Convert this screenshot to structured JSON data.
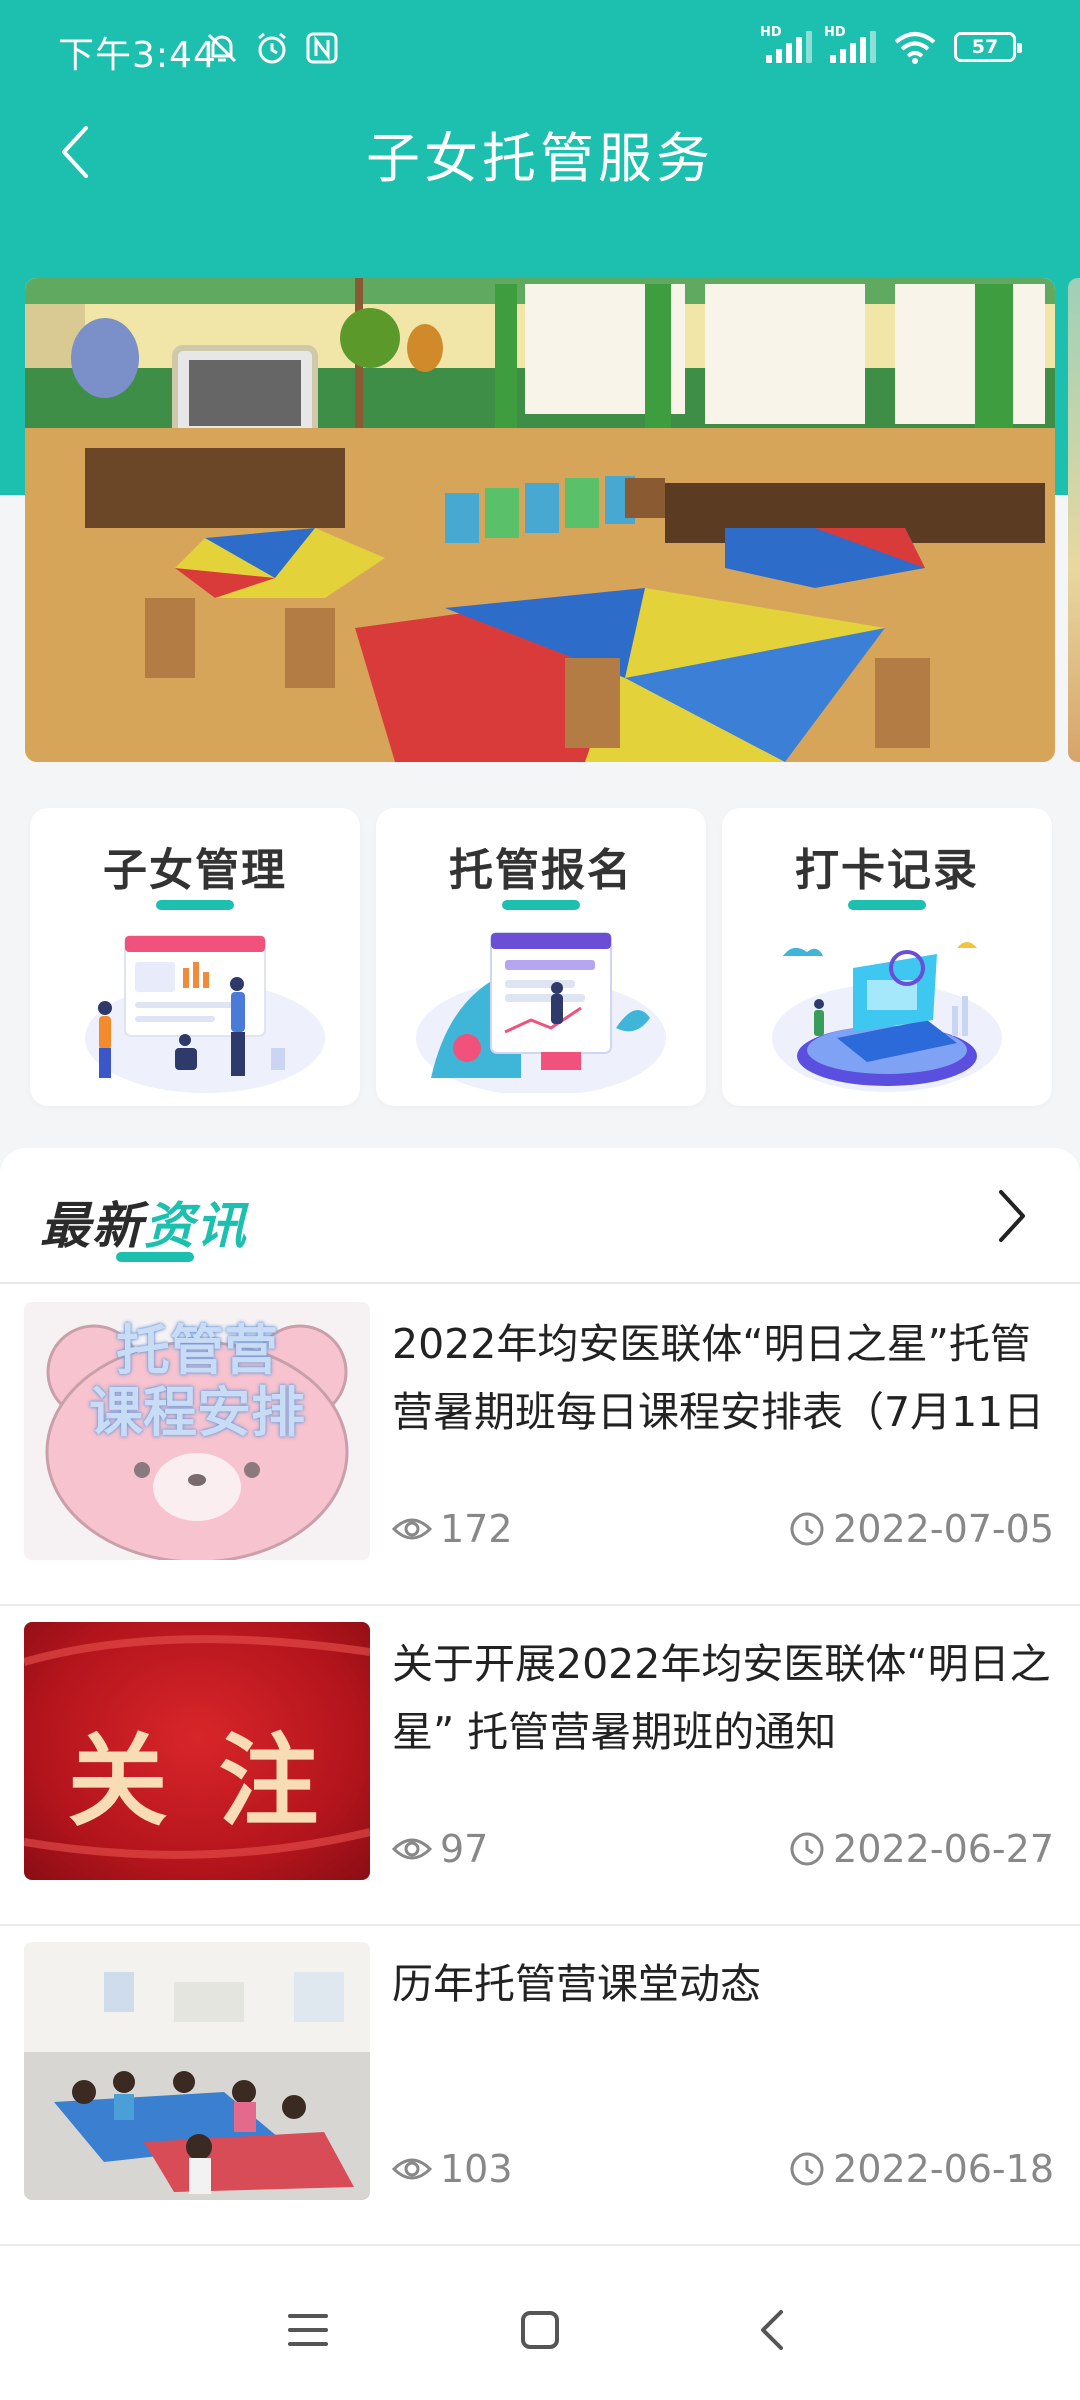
{
  "status_bar": {
    "time": "下午3:44",
    "signal_label_1": "HD",
    "signal_label_2": "HD",
    "battery": "57"
  },
  "header": {
    "title": "子女托管服务"
  },
  "quick_cards": [
    {
      "label": "子女管理"
    },
    {
      "label": "托管报名"
    },
    {
      "label": "打卡记录"
    }
  ],
  "news": {
    "title_part1": "最新",
    "title_part2": "资讯",
    "items": [
      {
        "thumb_text_1": "托管营",
        "thumb_text_2": "课程安排",
        "title": "2022年均安医联体“明日之星”托管营暑期班每日课程安排表（7月11日",
        "views": "172",
        "date": "2022-07-05"
      },
      {
        "thumb_text_1": "关 注",
        "title": "关于开展2022年均安医联体“明日之星” 托管营暑期班的通知",
        "views": "97",
        "date": "2022-06-27"
      },
      {
        "title": "历年托管营课堂动态",
        "views": "103",
        "date": "2022-06-18"
      }
    ]
  },
  "colors": {
    "accent": "#1dbfae",
    "background": "#f4f5f7"
  },
  "icons": {
    "back": "chevron-left-icon",
    "more": "chevron-right-icon",
    "views": "eye-icon",
    "date": "clock-icon"
  }
}
